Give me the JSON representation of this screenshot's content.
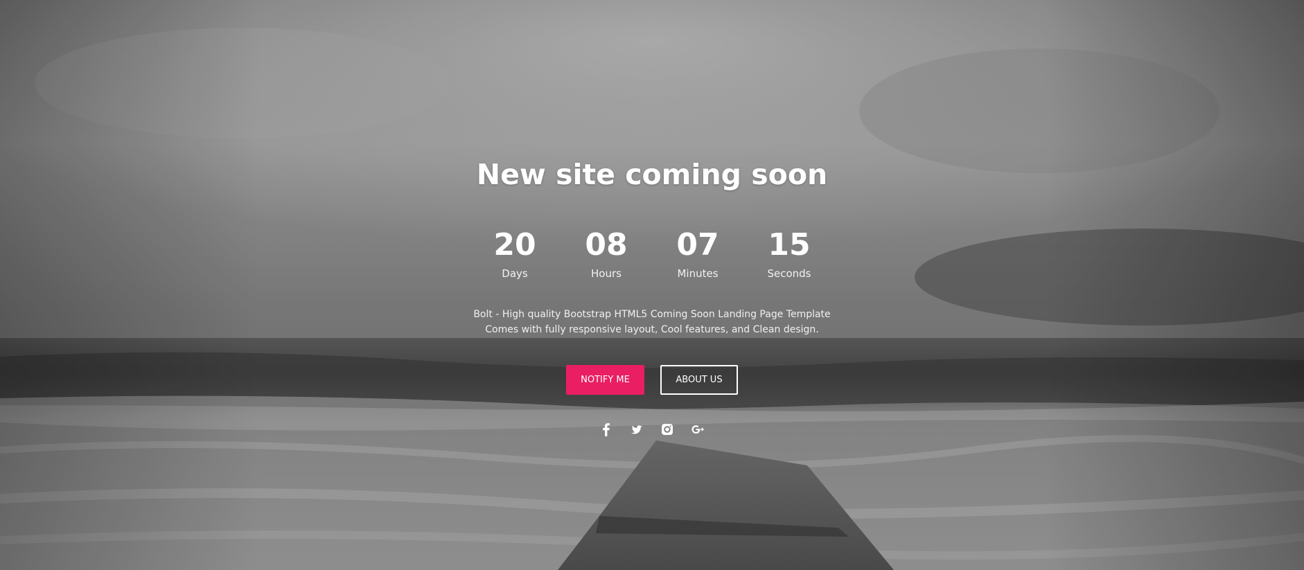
{
  "page": {
    "title": "New site coming soon"
  },
  "countdown": [
    {
      "value": "20",
      "label": "Days"
    },
    {
      "value": "08",
      "label": "Hours"
    },
    {
      "value": "07",
      "label": "Minutes"
    },
    {
      "value": "15",
      "label": "Seconds"
    }
  ],
  "description": {
    "line1": "Bolt - High quality Bootstrap HTML5 Coming Soon Landing Page Template",
    "line2": "Comes with fully responsive layout, Cool features, and Clean design."
  },
  "buttons": {
    "notify_label": "NOTIFY ME",
    "about_label": "ABOUT US"
  },
  "social": [
    {
      "icon": "facebook-icon"
    },
    {
      "icon": "twitter-icon"
    },
    {
      "icon": "instagram-icon"
    },
    {
      "icon": "google-plus-icon"
    }
  ],
  "colors": {
    "accent": "#e91e63",
    "text": "#ffffff"
  }
}
